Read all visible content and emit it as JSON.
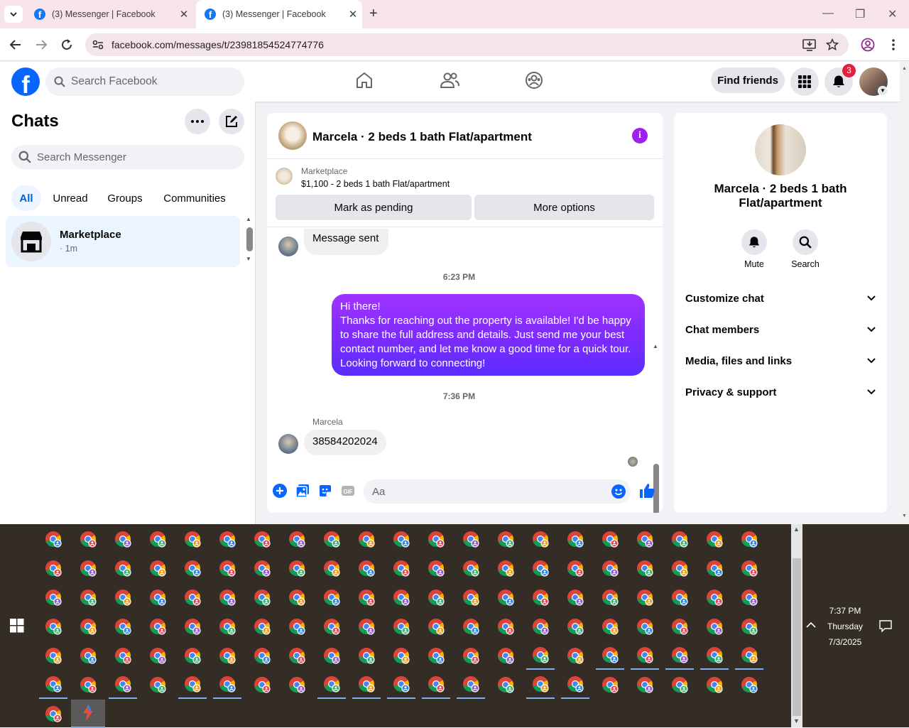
{
  "browser": {
    "tabs": [
      {
        "title": "(3) Messenger | Facebook"
      },
      {
        "title": "(3) Messenger | Facebook"
      }
    ],
    "url": "facebook.com/messages/t/23981854524774776"
  },
  "fb_header": {
    "search_placeholder": "Search Facebook",
    "find_friends": "Find friends",
    "notification_count": "3"
  },
  "sidebar": {
    "title": "Chats",
    "search_placeholder": "Search Messenger",
    "filters": [
      "All",
      "Unread",
      "Groups",
      "Communities"
    ],
    "conversation": {
      "name": "Marketplace",
      "time": "· 1m"
    }
  },
  "chat": {
    "title": "Marcela · 2 beds 1 bath Flat/apartment",
    "marketplace_label": "Marketplace",
    "listing": "$1,100 - 2 beds 1 bath Flat/apartment",
    "mark_pending": "Mark as pending",
    "more_options": "More options",
    "messages": {
      "sent_notice": "Message sent",
      "time1": "6:23 PM",
      "outgoing_lines": [
        "Hi there!",
        "Thanks for reaching out the property is available! I'd be happy",
        "to share the full address and details. Just send me your best",
        "contact number, and let me know a good time for a quick tour.",
        "Looking forward to connecting!"
      ],
      "time2": "7:36 PM",
      "sender": "Marcela",
      "incoming": "38584202024"
    },
    "input_placeholder": "Aa"
  },
  "info_panel": {
    "name": "Marcela · 2 beds 1 bath Flat/apartment",
    "mute": "Mute",
    "search": "Search",
    "sections": [
      "Customize chat",
      "Chat members",
      "Media, files and links",
      "Privacy & support"
    ]
  },
  "taskbar": {
    "time": "7:37 PM",
    "day": "Thursday",
    "date": "7/3/2025"
  },
  "colors": {
    "messenger_gradient_start": "#a033ff",
    "messenger_gradient_end": "#5b2dff",
    "fb_blue": "#0866ff",
    "badge_red": "#e41e3f"
  }
}
